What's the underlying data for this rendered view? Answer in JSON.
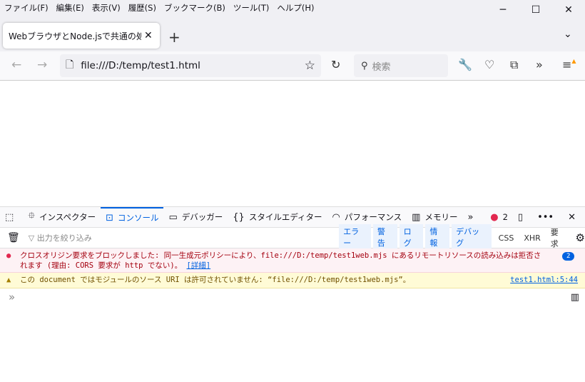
{
  "menu": [
    "ファイル(F)",
    "編集(E)",
    "表示(V)",
    "履歴(S)",
    "ブックマーク(B)",
    "ツール(T)",
    "ヘルプ(H)"
  ],
  "tab": {
    "title": "WebブラウザとNode.jsで共通の処理を"
  },
  "url": "file:///D:/temp/test1.html",
  "search_placeholder": "検索",
  "devtools": {
    "tabs": [
      "インスペクター",
      "コンソール",
      "デバッガー",
      "スタイルエディター",
      "パフォーマンス",
      "メモリー"
    ],
    "error_count": "2",
    "filter_placeholder": "出力を絞り込み",
    "filters": [
      "エラー",
      "警告",
      "ログ",
      "情報",
      "デバッグ"
    ],
    "extra_filters": [
      "CSS",
      "XHR",
      "要求"
    ],
    "error_line1": "クロスオリジン要求をブロックしました: 同一生成元ポリシーにより、file:///D:/temp/test1web.mjs にあるリモートリソースの読み込みは拒否さ",
    "error_line2": "れます (理由: CORS 要求が http でない)。",
    "error_link": "[詳細]",
    "error_repeat": "2",
    "warning": "この document ではモジュールのソース URI は許可されていません: “file:///D:/temp/test1web.mjs”。",
    "warning_source": "test1.html:5:44",
    "prompt": "»"
  }
}
